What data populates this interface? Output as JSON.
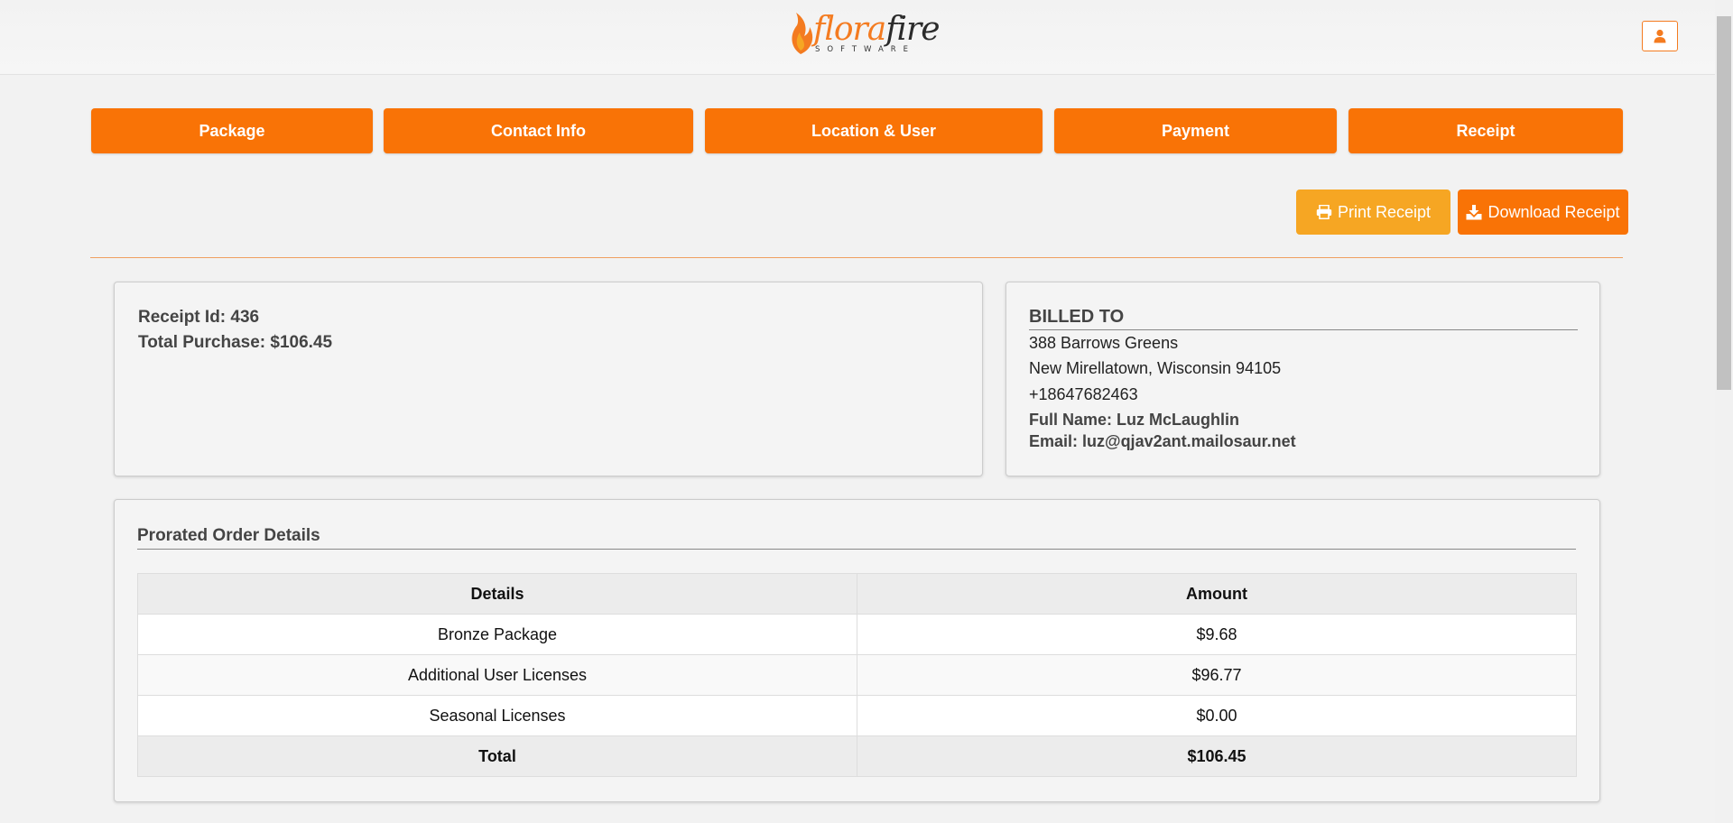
{
  "header": {
    "logo_word_a": "flora",
    "logo_word_b": "fire",
    "logo_sub": "SOFTWARE",
    "user_icon": "user-icon"
  },
  "steps": [
    "Package",
    "Contact Info",
    "Location & User",
    "Payment",
    "Receipt"
  ],
  "actions": {
    "print_label": "Print Receipt",
    "print_icon": "printer-icon",
    "download_label": "Download Receipt",
    "download_icon": "download-icon"
  },
  "receipt": {
    "id_line": "Receipt Id: 436",
    "total_line": "Total Purchase: $106.45"
  },
  "billed_to": {
    "title": "BILLED TO",
    "address1": "388 Barrows Greens",
    "address2": "New Mirellatown, Wisconsin 94105",
    "phone": "+18647682463",
    "full_name": "Full Name: Luz McLaughlin",
    "email": "Email: luz@qjav2ant.mailosaur.net"
  },
  "order": {
    "title": "Prorated Order Details",
    "headers": [
      "Details",
      "Amount"
    ],
    "rows": [
      [
        "Bronze Package",
        "$9.68"
      ],
      [
        "Additional User Licenses",
        "$96.77"
      ],
      [
        "Seasonal Licenses",
        "$0.00"
      ]
    ],
    "total": [
      "Total",
      "$106.45"
    ]
  },
  "colors": {
    "accent": "#f97306",
    "print_button": "#f6a623",
    "background": "#f2f2f2"
  }
}
